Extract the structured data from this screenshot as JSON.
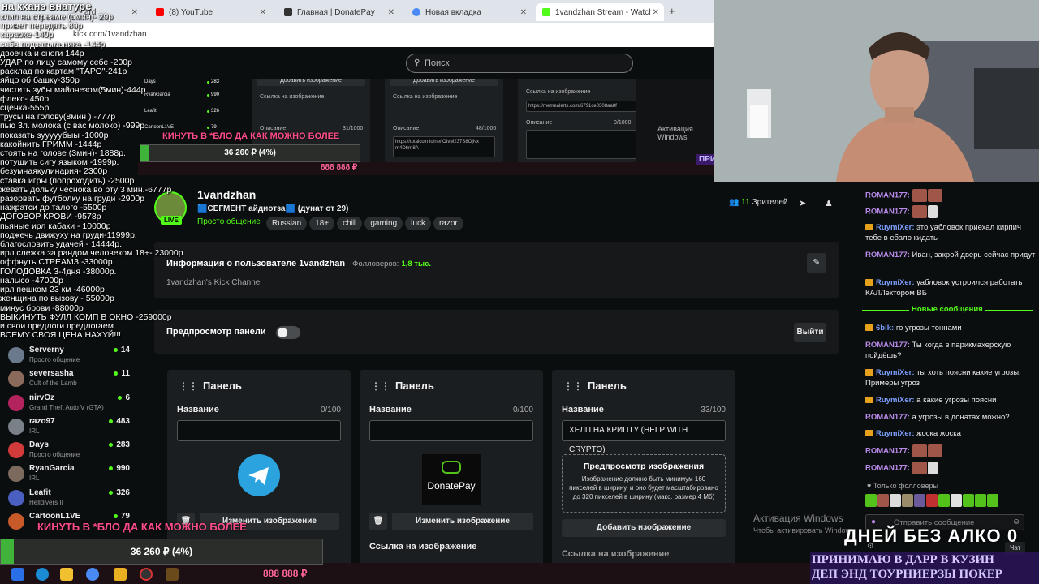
{
  "browser": {
    "tabs": [
      {
        "label": "ard",
        "icon": "generic"
      },
      {
        "label": "(8) YouTube",
        "icon": "youtube"
      },
      {
        "label": "Главная | DonatePay",
        "icon": "donatepay"
      },
      {
        "label": "Новая вкладка",
        "icon": "chrome"
      },
      {
        "label": "1vandzhan Stream - Watch Live",
        "icon": "kick"
      }
    ],
    "new_tab": "+",
    "url": "kick.com/1vandzhan"
  },
  "kick": {
    "search_placeholder": "Поиск",
    "channel": {
      "name": "1vandzhan",
      "live_badge": "LIVE",
      "stream_title": "🟦СЕГМЕНТ айдиотза🟦 (дунат от 29)",
      "category": "Просто общение",
      "tags": [
        "Russian",
        "18+",
        "chill",
        "gaming",
        "luck",
        "razor"
      ],
      "viewers_count": "11",
      "viewers_label": "Зрителей"
    },
    "about": {
      "title": "Информация о пользователе 1vandzhan",
      "followers_label": "Фолловеров:",
      "followers_value": "1,8 тыс.",
      "description": "1vandzhan's Kick Channel"
    },
    "panel_preview": {
      "label": "Предпросмотр панели",
      "exit": "Выйти"
    },
    "panels": [
      {
        "title": "Панель",
        "name_label": "Название",
        "count": "0/100",
        "value": "",
        "change_image": "Изменить изображение",
        "image": "telegram",
        "link_label": "Ссылка на изображение"
      },
      {
        "title": "Панель",
        "name_label": "Название",
        "count": "0/100",
        "value": "",
        "change_image": "Изменить изображение",
        "image": "donatepay",
        "image_text": "DonatePay",
        "link_label": "Ссылка на изображение"
      },
      {
        "title": "Панель",
        "name_label": "Название",
        "count": "33/100",
        "value": "ХЕЛП НА КРИПТУ (HELP WITH CRYPTO)",
        "preview_title": "Предпросмотр изображения",
        "preview_text": "Изображение должно быть минимум 160 пикселей в ширину, и оно будет масштабировано до 320 пикселей в ширину (макс. размер 4 Мб)",
        "add_image": "Добавить изображение",
        "link_label": "Ссылка на изображение"
      }
    ],
    "sidebar": [
      {
        "name": "Serverny",
        "game": "Просто общение",
        "viewers": "14",
        "color": "#6a7a8c"
      },
      {
        "name": "seversasha",
        "game": "Cult of the Lamb",
        "viewers": "11",
        "color": "#8a6a5a"
      },
      {
        "name": "nirvOz",
        "game": "Grand Theft Auto V (GTA)",
        "viewers": "6",
        "color": "#b3245e"
      },
      {
        "name": "razo97",
        "game": "IRL",
        "viewers": "483",
        "color": "#7a8088"
      },
      {
        "name": "Days",
        "game": "Просто общение",
        "viewers": "283",
        "color": "#d33a3a"
      },
      {
        "name": "RyanGarcia",
        "game": "IRL",
        "viewers": "990",
        "color": "#7d6a5e"
      },
      {
        "name": "Leafit",
        "game": "Helldivers II",
        "viewers": "326",
        "color": "#4a5fc0"
      },
      {
        "name": "CartoonL1VE",
        "game": "",
        "viewers": "79",
        "color": "#c85a2a"
      }
    ],
    "windows_activation": {
      "title": "Активация Windows",
      "subtitle": "Чтобы активировать Windows"
    }
  },
  "chat": {
    "messages": [
      {
        "user": "ROMAN177:",
        "text": "",
        "emotes": 2,
        "badge": false
      },
      {
        "user": "ROMAN177:",
        "text": "",
        "emotes": 2,
        "badge": false
      },
      {
        "user": "RuymiXer:",
        "text": "это уабловок приехал кирпич тебе в ебало кидать",
        "badge": true
      },
      {
        "user": "ROMAN177:",
        "text": "Иван, закрой дверь сейчас придут",
        "badge": false
      },
      {
        "user": "RuymiXer:",
        "text": "уабловок устроился работать КАЛЛектором ВБ",
        "badge": true
      }
    ],
    "new_messages": "Новые сообщения",
    "messages2": [
      {
        "user": "6blk:",
        "text": "го угрозы тоннами",
        "badge": true
      },
      {
        "user": "ROMAN177:",
        "text": "Ты когда в парикмахерскую пойдёшь?",
        "badge": false
      },
      {
        "user": "RuymiXer:",
        "text": "ты хоть поясни какие угрозы. Примеры угроз",
        "badge": true
      },
      {
        "user": "RuymiXer:",
        "text": "а какие угрозы поясни",
        "badge": true
      },
      {
        "user": "ROMAN177:",
        "text": "а угрозы в донатах можно?",
        "badge": false
      },
      {
        "user": "RuymiXer:",
        "text": "жоска жоска",
        "badge": true
      },
      {
        "user": "ROMAN177:",
        "text": "",
        "emotes": 2,
        "badge": false
      },
      {
        "user": "ROMAN177:",
        "text": "",
        "emotes": 2,
        "badge": false
      }
    ],
    "followers_only": "Только фолловеры",
    "input_placeholder": "Отправить сообщение",
    "chat_button": "Чат"
  },
  "overlay": {
    "donate_title": "на кханэ внатуре",
    "donate_items": [
      "клип на стреаме (5мин)- 29р",
      "привет передать 89р",
      "караоке-149р",
      "себе подзатыльника -144р",
      "двоечка и сноги 144р",
      "УДАР по лицу самому себе -200р",
      "расклад по картам \"ТАРО\"-241р",
      "яйцо об башку-350р",
      "чистить зубы майонезом(5мин)-444р.",
      "флекс- 450р",
      "сценка-555р",
      "трусы на голову(8мин ) -777р",
      "пью 3л. молока (с вас молоко) -999р",
      "показать зууууубыы -1000р",
      "какойнить ГРИММ -1444р",
      "стоять на голове (3мин)- 1888р.",
      "потушить сигу языком -1999р.",
      "безумнаякулинария- 2300р",
      "ставка игры (попроходить) -2500р",
      "жевать дольку чеснока во рту 3 мин.-6777р",
      "разорвать футболку на груди -2900р",
      "нажратси до талого -5500р",
      "ДОГОВОР КРОВИ -9578р",
      "пьяные ирл кабаки - 10000р",
      "поджечь движуху на груди-11999р.",
      "благословить удачей - 14444р.",
      "ирл слежка за рандом человеком 18+- 23000р",
      "оффнуть СТРЕАМЗ -33000р.",
      "ГОЛОДОВКА 3-4дня -38000р.",
      "налысо -47000р",
      "ирл пешком 23 км -46000р",
      "женщина по вызову - 55000р",
      "минус брови -88000р",
      "ВЫКИНУТЬ ФУЛЛ КОМП В ОКНО -259000р",
      "и свои предлоги предлогаем",
      "ВСЕМУ СВОЯ ЦЕНА НАХУЙ!!!"
    ],
    "red_banner": "КИНУТЬ В *БЛО ДА КАК МОЖНО БОЛЕЕ",
    "goal_text": "36 260 ₽ (4%)",
    "goal_fraction": 0.04,
    "ticker": "888 888 ₽",
    "days_no_alco": "ДНЕЙ БЕЗ АЛКО",
    "days_value": "0",
    "promo_line1": "ПРИНИМАЮ В ДАРР В КУЗИН",
    "promo_line2": "ДЕП ЭНД ТОУРНИЕРЗЫ ПОКЕР",
    "side_promo": "ПРИ ДЕП"
  }
}
